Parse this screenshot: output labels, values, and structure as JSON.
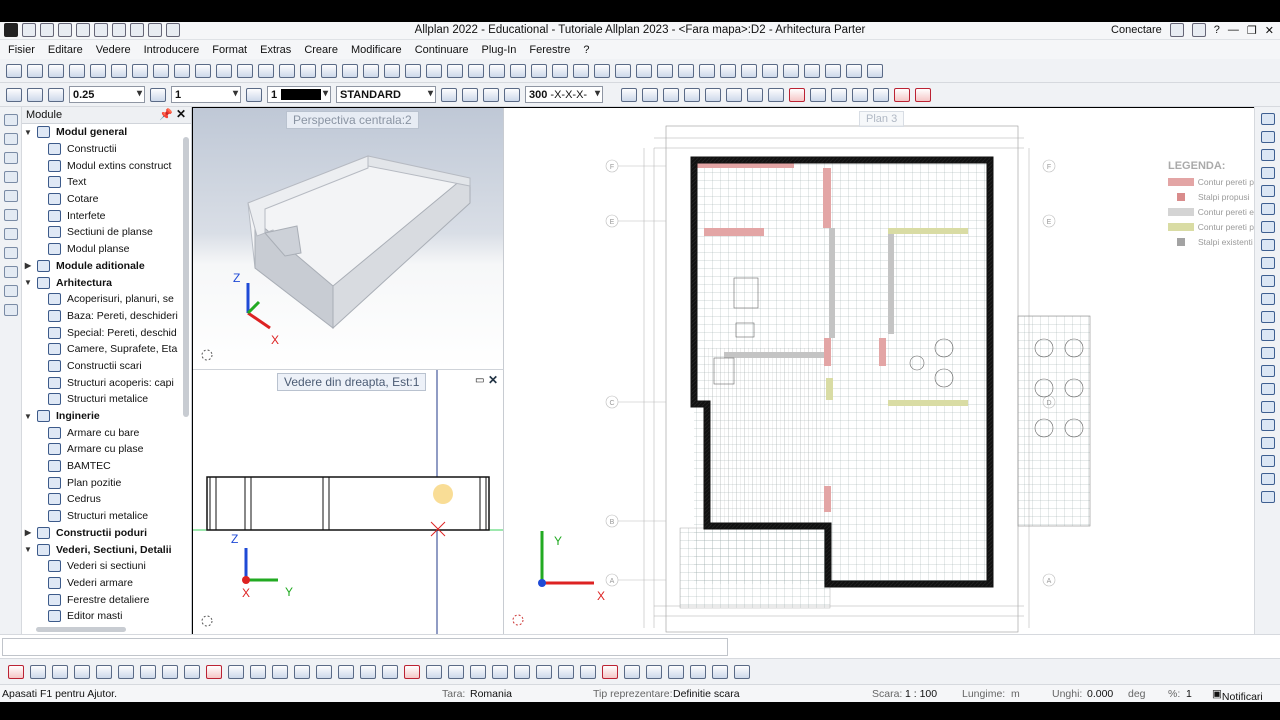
{
  "window": {
    "title": "Allplan 2022 - Educational - Tutoriale Allplan 2023 - <Fara mapa>:D2 - Arhitectura Parter",
    "connect_label": "Conectare",
    "help_label": "?"
  },
  "menu": [
    "Fisier",
    "Editare",
    "Vedere",
    "Introducere",
    "Format",
    "Extras",
    "Creare",
    "Modificare",
    "Continuare",
    "Plug-In",
    "Ferestre",
    "?"
  ],
  "format_bar": {
    "pen_thickness": "0.25",
    "line_type": "1",
    "color_number": "1",
    "layer": "STANDARD",
    "scale_field": "300",
    "scale_pattern": "-X-X-X-"
  },
  "module_panel": {
    "title": "Module",
    "tree": [
      {
        "label": "Modul general",
        "level": 0,
        "expanded": true,
        "icon": "module-general-icon"
      },
      {
        "label": "Constructii",
        "level": 1,
        "icon": "constructions-icon"
      },
      {
        "label": "Modul extins construct",
        "level": 1,
        "icon": "extended-construct-icon"
      },
      {
        "label": "Text",
        "level": 1,
        "icon": "text-icon"
      },
      {
        "label": "Cotare",
        "level": 1,
        "icon": "dimension-icon"
      },
      {
        "label": "Interfete",
        "level": 1,
        "icon": "interface-icon"
      },
      {
        "label": "Sectiuni de planse",
        "level": 1,
        "icon": "sheet-section-icon"
      },
      {
        "label": "Modul planse",
        "level": 1,
        "icon": "sheet-module-icon"
      },
      {
        "label": "Module aditionale",
        "level": 0,
        "expanded": false,
        "icon": "additional-modules-icon"
      },
      {
        "label": "Arhitectura",
        "level": 0,
        "expanded": true,
        "icon": "architecture-icon"
      },
      {
        "label": "Acoperisuri, planuri, se",
        "level": 1,
        "icon": "roofs-icon"
      },
      {
        "label": "Baza: Pereti, deschideri",
        "level": 1,
        "icon": "walls-icon"
      },
      {
        "label": "Special: Pereti, deschid",
        "level": 1,
        "icon": "special-walls-icon"
      },
      {
        "label": "Camere, Suprafete, Eta",
        "level": 1,
        "icon": "rooms-icon"
      },
      {
        "label": "Constructii scari",
        "level": 1,
        "icon": "stairs-icon"
      },
      {
        "label": "Structuri acoperis: capi",
        "level": 1,
        "icon": "roof-structure-icon"
      },
      {
        "label": "Structuri metalice",
        "level": 1,
        "icon": "steel-structure-icon"
      },
      {
        "label": "Inginerie",
        "level": 0,
        "expanded": true,
        "icon": "engineering-icon"
      },
      {
        "label": "Armare cu bare",
        "level": 1,
        "icon": "bar-reinforcement-icon"
      },
      {
        "label": "Armare cu plase",
        "level": 1,
        "icon": "mesh-reinforcement-icon"
      },
      {
        "label": "BAMTEC",
        "level": 1,
        "icon": "bamtec-icon"
      },
      {
        "label": "Plan pozitie",
        "level": 1,
        "icon": "position-plan-icon"
      },
      {
        "label": "Cedrus",
        "level": 1,
        "icon": "cedrus-icon"
      },
      {
        "label": "Structuri metalice",
        "level": 1,
        "icon": "steel-structure-icon"
      },
      {
        "label": "Constructii poduri",
        "level": 0,
        "expanded": false,
        "icon": "bridges-icon"
      },
      {
        "label": "Vederi, Sectiuni, Detalii",
        "level": 0,
        "expanded": true,
        "icon": "views-icon"
      },
      {
        "label": "Vederi si sectiuni",
        "level": 1,
        "icon": "views-sections-icon"
      },
      {
        "label": "Vederi armare",
        "level": 1,
        "icon": "reinforcement-views-icon"
      },
      {
        "label": "Ferestre detaliere",
        "level": 1,
        "icon": "detail-window-icon"
      },
      {
        "label": "Editor masti",
        "level": 1,
        "icon": "mask-editor-icon"
      }
    ]
  },
  "viewports": {
    "perspective_label": "Perspectiva centrala:2",
    "right_view_label": "Vedere din dreapta, Est:1",
    "plan_label": "Plan 3",
    "axis_x": "X",
    "axis_y": "Y",
    "axis_z": "Z"
  },
  "plan": {
    "legend_title": "LEGENDA:",
    "legend": [
      {
        "label": "Contur pereti p",
        "color": "#e3a5a5"
      },
      {
        "label": "Stalpi propusi",
        "color": "#d98c8c"
      },
      {
        "label": "Contur pereti e",
        "color": "#d4d4d4"
      },
      {
        "label": "Contur pereti p",
        "color": "#d9dca4"
      },
      {
        "label": "Stalpi existenti",
        "color": "#a3a3a3"
      }
    ],
    "grid_labels": [
      "F",
      "E",
      "D",
      "C",
      "B",
      "A"
    ]
  },
  "status": {
    "help": "Apasati F1 pentru Ajutor.",
    "country_label": "Tara:",
    "country": "Romania",
    "repr_label": "Tip reprezentare:",
    "repr": "Definitie scara",
    "scale_label": "Scara:",
    "scale": "1 : 100",
    "length_label": "Lungime:",
    "length_unit": "m",
    "angle_label": "Unghi:",
    "angle": "0.000",
    "angle_unit": "deg",
    "percent_label": "%:",
    "percent": "1",
    "notify": "Notificari"
  }
}
